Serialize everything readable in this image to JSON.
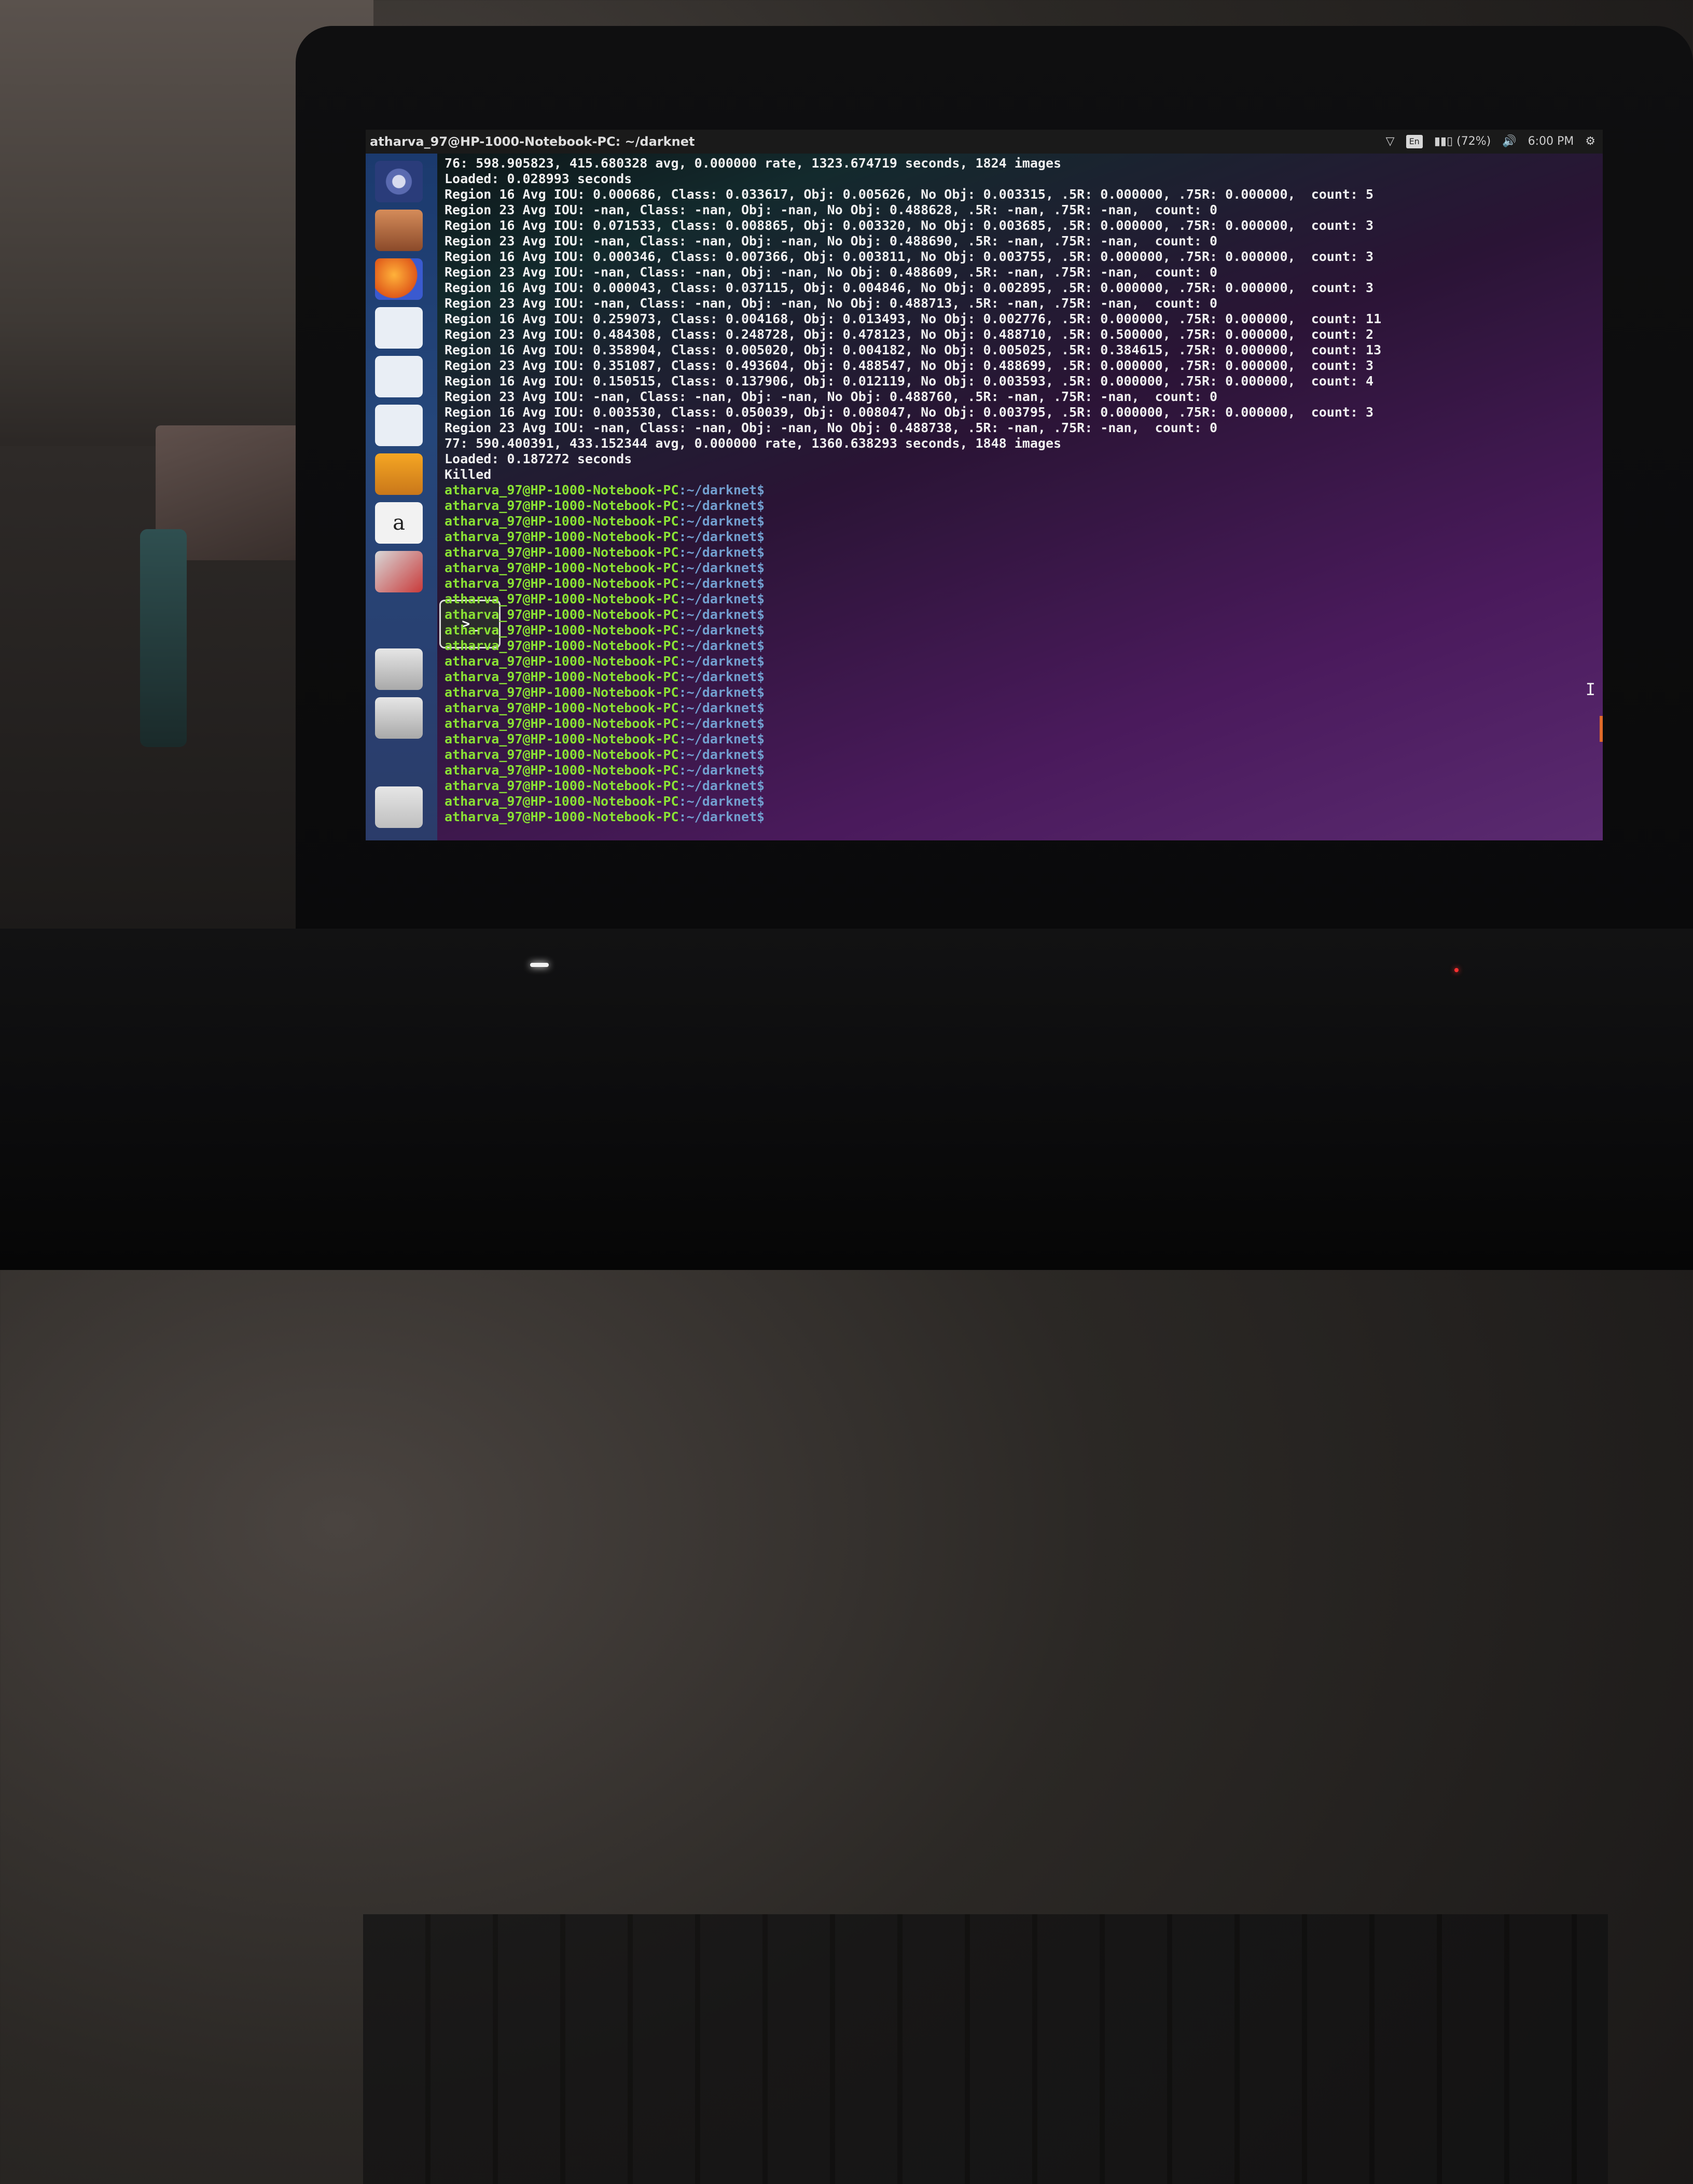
{
  "window": {
    "title": "atharva_97@HP-1000-Notebook-PC: ~/darknet"
  },
  "indicators": {
    "battery": "(72%)",
    "keyboard": "En",
    "time": "6:00 PM"
  },
  "terminal": {
    "output": [
      "76: 598.905823, 415.680328 avg, 0.000000 rate, 1323.674719 seconds, 1824 images",
      "Loaded: 0.028993 seconds",
      "Region 16 Avg IOU: 0.000686, Class: 0.033617, Obj: 0.005626, No Obj: 0.003315, .5R: 0.000000, .75R: 0.000000,  count: 5",
      "Region 23 Avg IOU: -nan, Class: -nan, Obj: -nan, No Obj: 0.488628, .5R: -nan, .75R: -nan,  count: 0",
      "Region 16 Avg IOU: 0.071533, Class: 0.008865, Obj: 0.003320, No Obj: 0.003685, .5R: 0.000000, .75R: 0.000000,  count: 3",
      "Region 23 Avg IOU: -nan, Class: -nan, Obj: -nan, No Obj: 0.488690, .5R: -nan, .75R: -nan,  count: 0",
      "Region 16 Avg IOU: 0.000346, Class: 0.007366, Obj: 0.003811, No Obj: 0.003755, .5R: 0.000000, .75R: 0.000000,  count: 3",
      "Region 23 Avg IOU: -nan, Class: -nan, Obj: -nan, No Obj: 0.488609, .5R: -nan, .75R: -nan,  count: 0",
      "Region 16 Avg IOU: 0.000043, Class: 0.037115, Obj: 0.004846, No Obj: 0.002895, .5R: 0.000000, .75R: 0.000000,  count: 3",
      "Region 23 Avg IOU: -nan, Class: -nan, Obj: -nan, No Obj: 0.488713, .5R: -nan, .75R: -nan,  count: 0",
      "Region 16 Avg IOU: 0.259073, Class: 0.004168, Obj: 0.013493, No Obj: 0.002776, .5R: 0.000000, .75R: 0.000000,  count: 11",
      "Region 23 Avg IOU: 0.484308, Class: 0.248728, Obj: 0.478123, No Obj: 0.488710, .5R: 0.500000, .75R: 0.000000,  count: 2",
      "Region 16 Avg IOU: 0.358904, Class: 0.005020, Obj: 0.004182, No Obj: 0.005025, .5R: 0.384615, .75R: 0.000000,  count: 13",
      "Region 23 Avg IOU: 0.351087, Class: 0.493604, Obj: 0.488547, No Obj: 0.488699, .5R: 0.000000, .75R: 0.000000,  count: 3",
      "Region 16 Avg IOU: 0.150515, Class: 0.137906, Obj: 0.012119, No Obj: 0.003593, .5R: 0.000000, .75R: 0.000000,  count: 4",
      "Region 23 Avg IOU: -nan, Class: -nan, Obj: -nan, No Obj: 0.488760, .5R: -nan, .75R: -nan,  count: 0",
      "Region 16 Avg IOU: 0.003530, Class: 0.050039, Obj: 0.008047, No Obj: 0.003795, .5R: 0.000000, .75R: 0.000000,  count: 3",
      "Region 23 Avg IOU: -nan, Class: -nan, Obj: -nan, No Obj: 0.488738, .5R: -nan, .75R: -nan,  count: 0",
      "77: 590.400391, 433.152344 avg, 0.000000 rate, 1360.638293 seconds, 1848 images",
      "Loaded: 0.187272 seconds",
      "Killed"
    ],
    "prompt_user": "atharva_97@HP-1000-Notebook-PC",
    "prompt_path": ":~/darknet$",
    "prompt_count": 22
  }
}
